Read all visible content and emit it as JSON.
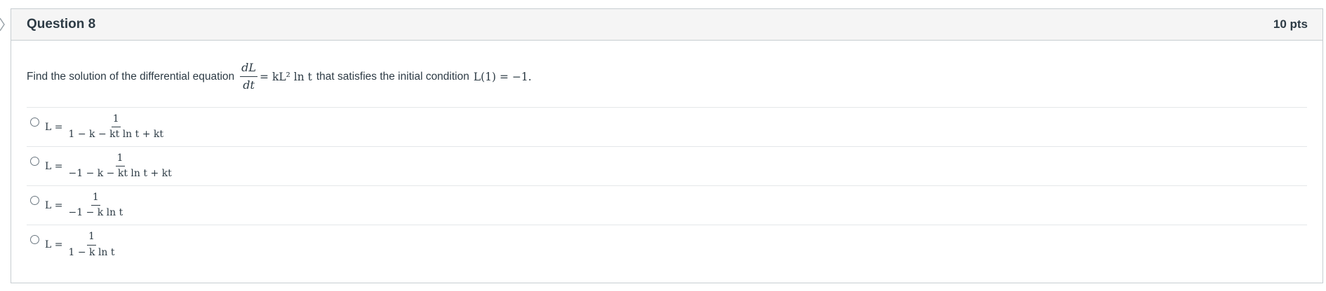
{
  "question": {
    "title": "Question 8",
    "points": "10 pts",
    "prompt_before": "Find the solution of the differential equation",
    "prompt_dl": "dL",
    "prompt_dt": "dt",
    "prompt_rhs": "= kL² ln t",
    "prompt_middle": "that satisfies the initial condition",
    "prompt_condition": "L(1) = −1."
  },
  "answers": [
    {
      "lhs": "L =",
      "numerator": "1",
      "denominator": "1 − k − kt ln t + kt"
    },
    {
      "lhs": "L =",
      "numerator": "1",
      "denominator": "−1 − k − kt ln t + kt"
    },
    {
      "lhs": "L =",
      "numerator": "1",
      "denominator": "−1 − k ln t"
    },
    {
      "lhs": "L =",
      "numerator": "1",
      "denominator": "1 − k ln t"
    }
  ]
}
